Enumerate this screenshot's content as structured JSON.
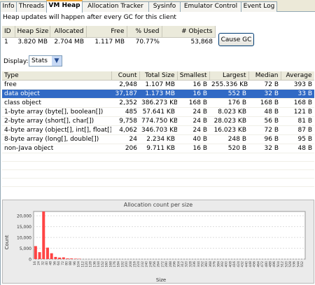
{
  "tabs": [
    {
      "label": "Info",
      "active": false
    },
    {
      "label": "Threads",
      "active": false
    },
    {
      "label": "VM Heap",
      "active": true
    },
    {
      "label": "Allocation Tracker",
      "active": false
    },
    {
      "label": "Sysinfo",
      "active": false
    },
    {
      "label": "Emulator Control",
      "active": false
    },
    {
      "label": "Event Log",
      "active": false
    }
  ],
  "info_text": "Heap updates will happen after every GC for this client",
  "heap_table": {
    "headers": [
      "ID",
      "Heap Size",
      "Allocated",
      "Free",
      "% Used",
      "# Objects"
    ],
    "row": [
      "1",
      "3.820 MB",
      "2.704 MB",
      "1.117 MB",
      "70.77%",
      "53,868"
    ]
  },
  "cause_gc_label": "Cause GC",
  "display": {
    "label": "Display:",
    "selected": "Stats"
  },
  "stats_table": {
    "headers": [
      "Type",
      "Count",
      "Total Size",
      "Smallest",
      "Largest",
      "Median",
      "Average"
    ],
    "rows": [
      [
        "free",
        "2,948",
        "1.107 MB",
        "16 B",
        "255.336 KB",
        "72 B",
        "393 B"
      ],
      [
        "data object",
        "37,187",
        "1.173 MB",
        "16 B",
        "552 B",
        "32 B",
        "33 B"
      ],
      [
        "class object",
        "2,352",
        "386.273 KB",
        "168 B",
        "176 B",
        "168 B",
        "168 B"
      ],
      [
        "1-byte array (byte[], boolean[])",
        "485",
        "57.641 KB",
        "24 B",
        "8.023 KB",
        "48 B",
        "121 B"
      ],
      [
        "2-byte array (short[], char[])",
        "9,758",
        "774.750 KB",
        "24 B",
        "28.023 KB",
        "56 B",
        "81 B"
      ],
      [
        "4-byte array (object[], int[], float[])",
        "4,062",
        "346.703 KB",
        "24 B",
        "16.023 KB",
        "72 B",
        "87 B"
      ],
      [
        "8-byte array (long[], double[])",
        "24",
        "2.234 KB",
        "40 B",
        "248 B",
        "96 B",
        "95 B"
      ],
      [
        "non-Java object",
        "206",
        "9.711 KB",
        "16 B",
        "520 B",
        "32 B",
        "48 B"
      ]
    ],
    "selected_row": 1
  },
  "chart_data": {
    "type": "bar",
    "title": "Allocation count per size",
    "xlabel": "Size",
    "ylabel": "Count",
    "ylim": [
      0,
      22000
    ],
    "yticks": [
      "0",
      "5,000",
      "10,000",
      "15,000",
      "20,000"
    ],
    "categories": [
      "16",
      "24",
      "32",
      "40",
      "48",
      "56",
      "64",
      "72",
      "80",
      "88",
      "96",
      "104",
      "112",
      "120",
      "128",
      "136",
      "144",
      "152",
      "160",
      "168",
      "176",
      "184",
      "192",
      "200",
      "208",
      "216",
      "224",
      "232",
      "240",
      "248",
      "256",
      "264",
      "272",
      "280",
      "288",
      "296",
      "304",
      "312",
      "320",
      "328",
      "336",
      "344",
      "352",
      "360",
      "368",
      "376",
      "384",
      "392",
      "400",
      "408",
      "416",
      "424",
      "432",
      "440",
      "448",
      "456",
      "464",
      "472",
      "480",
      "488",
      "496",
      "504",
      "512",
      "520",
      "528",
      "536",
      "544",
      "552"
    ],
    "x_tick_labels": [
      "16",
      "24",
      "32",
      "40",
      "48",
      "56",
      "64",
      "72",
      "80",
      "88",
      "96",
      "104",
      "112",
      "120",
      "128",
      "136",
      "144",
      "152",
      "160",
      "168",
      "176",
      "184",
      "192",
      "200",
      "208",
      "216",
      "224",
      "232",
      "240",
      "248",
      "256",
      "264",
      "272",
      "280",
      "288",
      "296",
      "304",
      "312",
      "320",
      "328",
      "336",
      "344",
      "352",
      "360",
      "368",
      "376",
      "384",
      "392",
      "400",
      "408",
      "416",
      "424",
      "432",
      "440",
      "448",
      "456",
      "464",
      "472",
      "480",
      "488",
      "496",
      "504",
      "512",
      "520",
      "528",
      "536",
      "544",
      "552"
    ],
    "values": [
      6000,
      3200,
      22000,
      5300,
      2700,
      1000,
      700,
      800,
      300,
      300,
      200,
      150,
      0,
      0,
      0,
      0,
      0,
      0,
      0,
      0,
      0,
      0,
      0,
      0,
      0,
      0,
      0,
      0,
      0,
      0,
      0,
      0,
      0,
      0,
      0,
      0,
      0,
      0,
      0,
      0,
      0,
      0,
      0,
      0,
      0,
      0,
      0,
      0,
      0,
      0,
      0,
      0,
      0,
      0,
      0,
      0,
      0,
      0,
      0,
      0,
      0,
      0,
      0,
      0,
      0,
      0,
      0,
      0
    ],
    "bar_color": "#ff4444",
    "grid": true
  }
}
